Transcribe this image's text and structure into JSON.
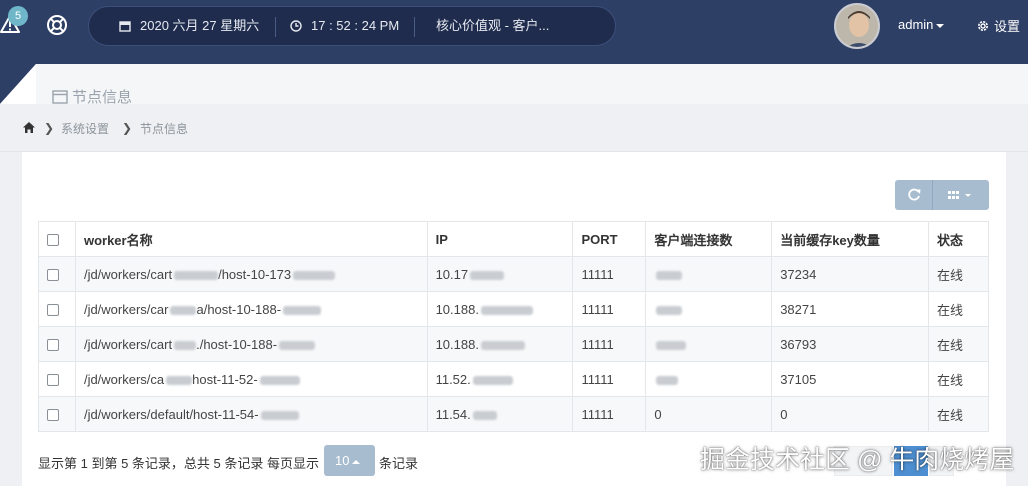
{
  "topbar": {
    "alert_badge": "5",
    "datetime": {
      "date": "2020 六月 27 星期六",
      "time": "17 : 52 : 24 PM"
    },
    "marquee": "核心价值观   -   客户...",
    "user": "admin",
    "settings_label": "设置"
  },
  "page": {
    "title": "节点信息",
    "breadcrumb": [
      "系统设置",
      "节点信息"
    ]
  },
  "table": {
    "columns": [
      "worker名称",
      "IP",
      "PORT",
      "客户端连接数",
      "当前缓存key数量",
      "状态"
    ],
    "rows": [
      {
        "name": "/jd/workers/cart",
        "ip": "10.17",
        "port": "11111",
        "clients": "",
        "keys": "37234",
        "status": "在线"
      },
      {
        "name": "/jd/workers/car",
        "ip": "10.188.",
        "port": "11111",
        "clients": "",
        "keys": "38271",
        "status": "在线"
      },
      {
        "name": "/jd/workers/cart",
        "ip": "10.188.",
        "port": "11111",
        "clients": "",
        "keys": "36793",
        "status": "在线"
      },
      {
        "name": "/jd/workers/ca",
        "ip": "11.52.",
        "port": "11111",
        "clients": "",
        "keys": "37105",
        "status": "在线"
      },
      {
        "name": "/jd/workers/default/host-11-54-",
        "ip": "11.54.",
        "port": "11111",
        "clients": "0",
        "keys": "0",
        "status": "在线"
      }
    ]
  },
  "footer": {
    "summary": "显示第 1 到第 5 条记录，总共 5 条记录 每页显示",
    "page_size": "10",
    "suffix": "条记录"
  },
  "watermark": "掘金技术社区 @ 牛肉烧烤屋",
  "colors": {
    "topbar": "#2e3f66",
    "accent_button": "#a8bccf",
    "badge": "#6fb6c9"
  }
}
